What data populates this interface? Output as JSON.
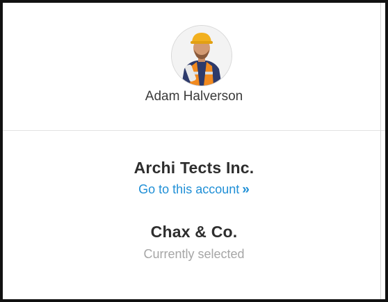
{
  "user": {
    "name": "Adam Halverson"
  },
  "accounts": [
    {
      "name": "Archi Tects Inc.",
      "action_label": "Go to this account",
      "action_icon": "double-chevron-right-icon"
    },
    {
      "name": "Chax & Co.",
      "status": "Currently selected"
    }
  ],
  "colors": {
    "link": "#1f8fd6",
    "muted": "#a6a6a6",
    "text": "#2e2e2e"
  }
}
